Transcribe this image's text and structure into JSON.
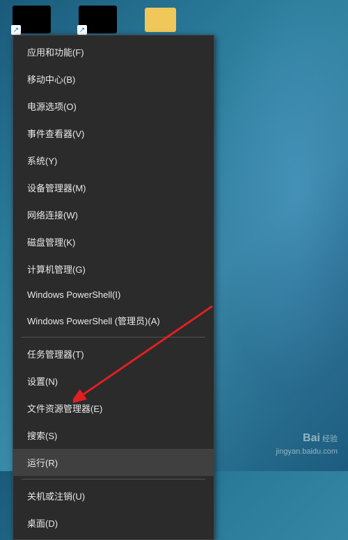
{
  "menu": {
    "items": [
      {
        "label": "应用和功能(F)"
      },
      {
        "label": "移动中心(B)"
      },
      {
        "label": "电源选项(O)"
      },
      {
        "label": "事件查看器(V)"
      },
      {
        "label": "系统(Y)"
      },
      {
        "label": "设备管理器(M)"
      },
      {
        "label": "网络连接(W)"
      },
      {
        "label": "磁盘管理(K)"
      },
      {
        "label": "计算机管理(G)"
      },
      {
        "label": "Windows PowerShell(I)"
      },
      {
        "label": "Windows PowerShell (管理员)(A)"
      }
    ],
    "items2": [
      {
        "label": "任务管理器(T)"
      },
      {
        "label": "设置(N)"
      },
      {
        "label": "文件资源管理器(E)"
      },
      {
        "label": "搜索(S)"
      },
      {
        "label": "运行(R)",
        "highlighted": true
      }
    ],
    "items3": [
      {
        "label": "关机或注销(U)"
      },
      {
        "label": "桌面(D)"
      }
    ]
  },
  "watermark": {
    "logo": "Bai",
    "brand": "经验",
    "url": "jingyan.baidu.com"
  }
}
